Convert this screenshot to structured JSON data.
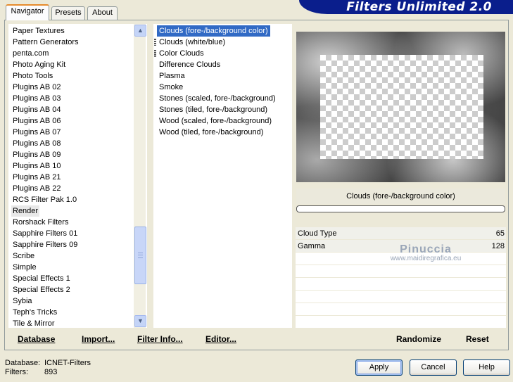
{
  "app": {
    "title": "Filters Unlimited 2.0"
  },
  "tabs": [
    {
      "label": "Navigator",
      "active": true
    },
    {
      "label": "Presets",
      "active": false
    },
    {
      "label": "About",
      "active": false
    }
  ],
  "categories": [
    "Paper Textures",
    "Pattern Generators",
    "penta.com",
    "Photo Aging Kit",
    "Photo Tools",
    "Plugins AB 02",
    "Plugins AB 03",
    "Plugins AB 04",
    "Plugins AB 06",
    "Plugins AB 07",
    "Plugins AB 08",
    "Plugins AB 09",
    "Plugins AB 10",
    "Plugins AB 21",
    "Plugins AB 22",
    "RCS Filter Pak 1.0",
    "Render",
    "Rorshack Filters",
    "Sapphire Filters 01",
    "Sapphire Filters 09",
    "Scribe",
    "Simple",
    "Special Effects 1",
    "Special Effects 2",
    "Sybia",
    "Teph's Tricks",
    "Tile & Mirror"
  ],
  "selected_category": "Render",
  "filters": [
    {
      "label": "Clouds (fore-/background color)",
      "selected": true,
      "marker": false
    },
    {
      "label": "Clouds (white/blue)",
      "selected": false,
      "marker": true
    },
    {
      "label": "Color Clouds",
      "selected": false,
      "marker": true
    },
    {
      "label": "Difference Clouds",
      "selected": false,
      "marker": false
    },
    {
      "label": "Plasma",
      "selected": false,
      "marker": false
    },
    {
      "label": "Smoke",
      "selected": false,
      "marker": false
    },
    {
      "label": "Stones (scaled, fore-/background)",
      "selected": false,
      "marker": false
    },
    {
      "label": "Stones (tiled, fore-/background)",
      "selected": false,
      "marker": false
    },
    {
      "label": "Wood (scaled, fore-/background)",
      "selected": false,
      "marker": false
    },
    {
      "label": "Wood (tiled, fore-/background)",
      "selected": false,
      "marker": false
    }
  ],
  "preview": {
    "filter_title": "Clouds (fore-/background color)"
  },
  "params": [
    {
      "label": "Cloud Type",
      "value": "65"
    },
    {
      "label": "Gamma",
      "value": "128"
    }
  ],
  "watermark": {
    "name": "Pinuccia",
    "url": "www.maidiregrafica.eu"
  },
  "links": {
    "database": "Database",
    "import": "Import...",
    "filter_info": "Filter Info...",
    "editor": "Editor...",
    "randomize": "Randomize",
    "reset": "Reset"
  },
  "footer": {
    "database_label": "Database:",
    "database_value": "ICNET-Filters",
    "filters_label": "Filters:",
    "filters_value": "893"
  },
  "buttons": {
    "apply": "Apply",
    "cancel": "Cancel",
    "help": "Help"
  },
  "colors": {
    "banner": "#0a1e8c",
    "selection": "#316ac5",
    "dialog_bg": "#ece9d8"
  },
  "icons": {
    "scroll_up": "chevron-up-icon",
    "scroll_down": "chevron-down-icon"
  }
}
